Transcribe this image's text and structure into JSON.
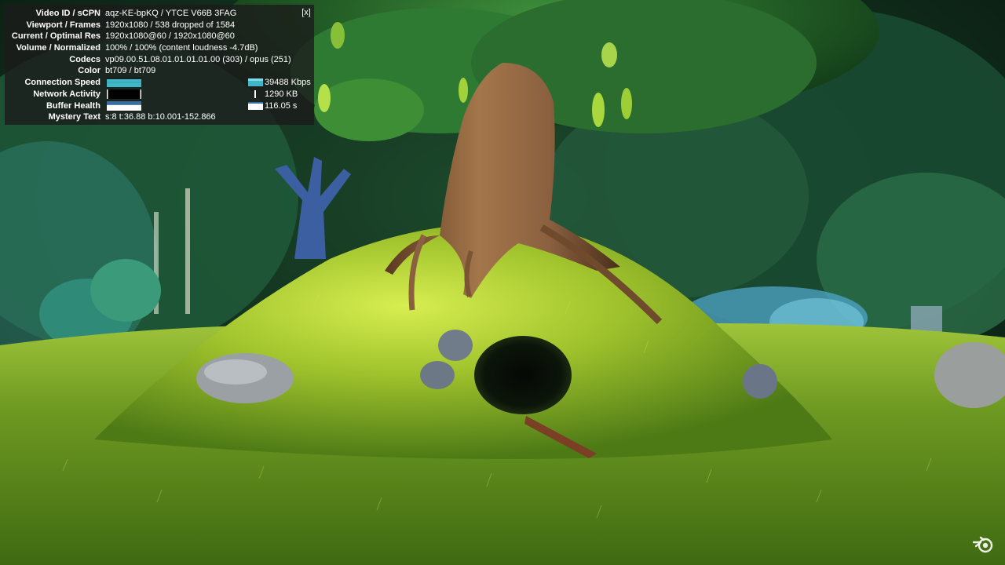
{
  "stats": {
    "close_label": "[x]",
    "rows": [
      {
        "label": "Video ID / sCPN",
        "value": "aqz-KE-bpKQ / YTCE V66B 3FAG"
      },
      {
        "label": "Viewport / Frames",
        "value": "1920x1080 / 538 dropped of 1584"
      },
      {
        "label": "Current / Optimal Res",
        "value": "1920x1080@60 / 1920x1080@60"
      },
      {
        "label": "Volume / Normalized",
        "value": "100% / 100% (content loudness -4.7dB)"
      },
      {
        "label": "Codecs",
        "value": "vp09.00.51.08.01.01.01.01.00 (303) / opus (251)"
      },
      {
        "label": "Color",
        "value": "bt709 / bt709"
      }
    ],
    "graphs": [
      {
        "label": "Connection Speed",
        "value": "39488 Kbps",
        "level": 0.85,
        "color": "#3fb7c9"
      },
      {
        "label": "Network Activity",
        "value": "1290 KB",
        "level": 0.15,
        "color": "#ffffff"
      },
      {
        "label": "Buffer Health",
        "value": "116.05 s",
        "level": 0.6,
        "color": "#ffffff"
      }
    ],
    "mystery": {
      "label": "Mystery Text",
      "value": "s:8 t:36.88 b:10.001-152.866"
    }
  },
  "video": {
    "watermark_icon": "blender-logo-icon"
  }
}
